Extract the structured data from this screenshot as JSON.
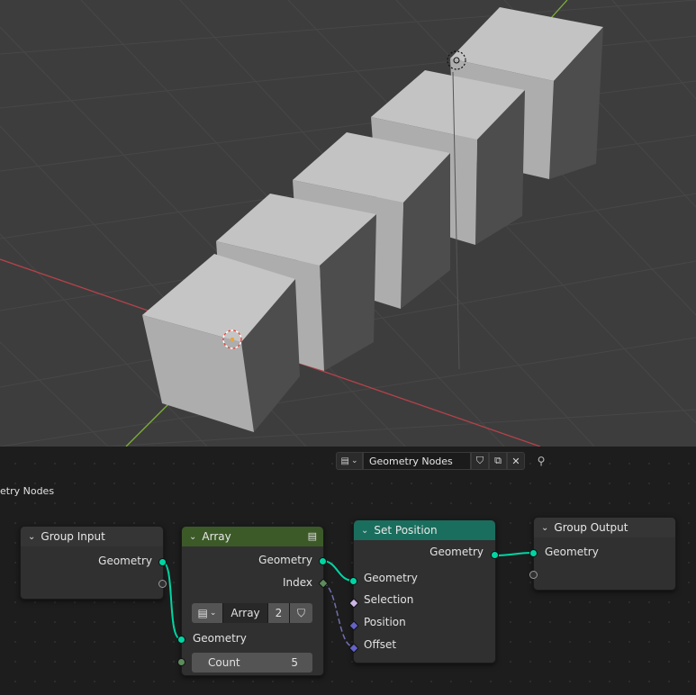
{
  "viewport": {
    "colors": {
      "background": "#3d3d3d",
      "grid": "#4a4a4a",
      "x_axis": "#b5424a",
      "y_axis": "#7fb03a",
      "cube_top": "#c1c1c1",
      "cube_front": "#a9a9a9",
      "cube_side": "#4d4d4d"
    },
    "icons": [
      "empty-object-icon",
      "3d-cursor-icon"
    ]
  },
  "editor_header": {
    "type_icon": "node-tree-icon",
    "tree_name": "Geometry Nodes",
    "fake_user_icon": "shield-icon",
    "duplicate_icon": "duplicate-icon",
    "close_icon": "close-icon",
    "pin_icon": "pin-icon"
  },
  "breadcrumb": "etry Nodes",
  "nodes": {
    "group_input": {
      "title": "Group Input",
      "outputs": [
        "Geometry"
      ]
    },
    "array": {
      "title": "Array",
      "outputs": [
        "Geometry",
        "Index"
      ],
      "subgroup": {
        "name": "Array",
        "users": "2"
      },
      "inputs": [
        "Geometry"
      ],
      "count": {
        "label": "Count",
        "value": "5"
      },
      "header_color": "#3c5a28"
    },
    "set_position": {
      "title": "Set Position",
      "outputs": [
        "Geometry"
      ],
      "inputs": [
        "Geometry",
        "Selection",
        "Position",
        "Offset"
      ],
      "header_color": "#1a6e5e"
    },
    "group_output": {
      "title": "Group Output",
      "inputs": [
        "Geometry"
      ]
    }
  },
  "glyphs": {
    "chevron": "⌄",
    "dropdown": "⌄",
    "shield": "⛉",
    "copy": "⧉",
    "close": "✕",
    "pin": "⚲",
    "node_icon": "▤"
  }
}
